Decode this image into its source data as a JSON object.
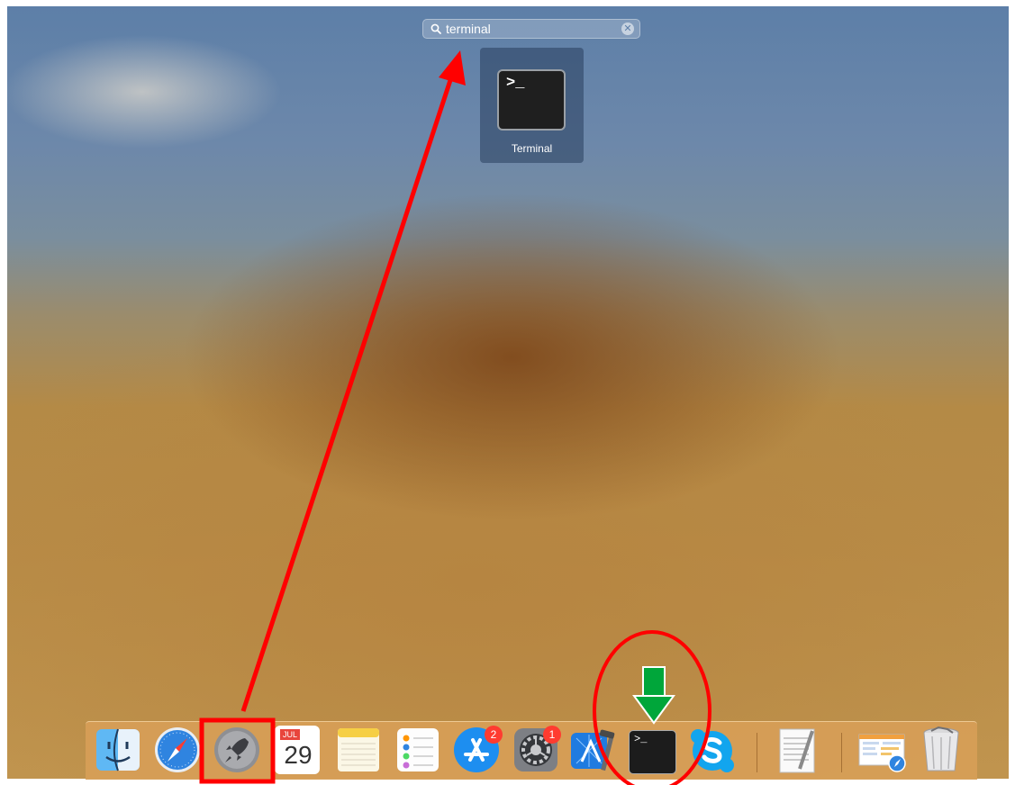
{
  "search": {
    "value": "terminal"
  },
  "result": {
    "label": "Terminal",
    "prompt": ">_"
  },
  "dock": {
    "calendar": {
      "month": "JUL",
      "day": "29"
    },
    "app_store_badge": "2",
    "system_prefs_badge": "1",
    "terminal_prompt": ">_"
  },
  "colors": {
    "annotation_red": "#ff0000",
    "annotation_green": "#00a63a",
    "badge_red": "#ff3b30"
  }
}
